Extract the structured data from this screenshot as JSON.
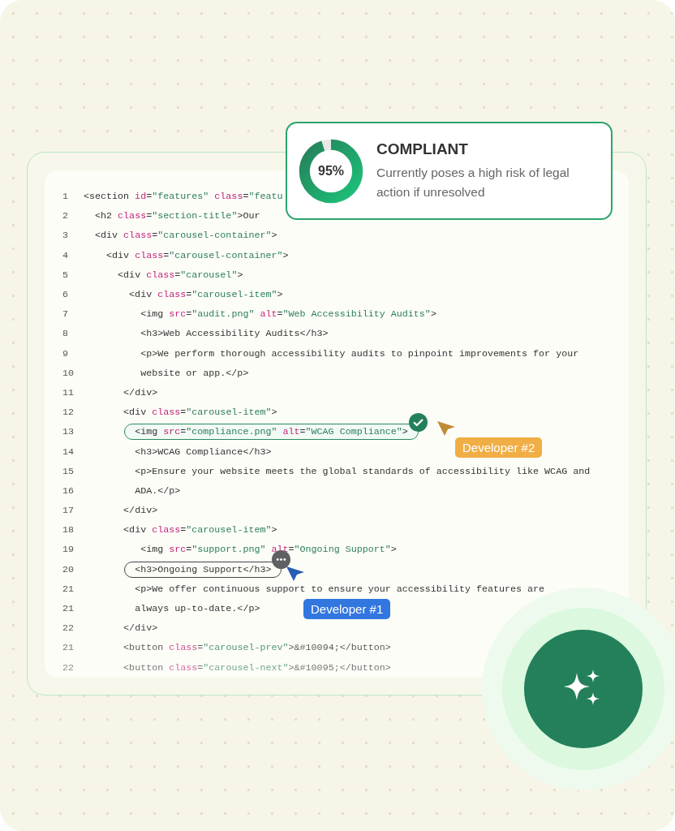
{
  "compliance_card": {
    "score": "95%",
    "level": 0.95,
    "title": "COMPLIANT",
    "description": "Currently poses a high risk of legal action if unresolved"
  },
  "code_lines": [
    {
      "number": "1",
      "tokens": [
        {
          "kind": "tag",
          "text": "<section"
        },
        {
          "kind": "attr",
          "text": " id"
        },
        {
          "kind": "tag",
          "text": "="
        },
        {
          "kind": "str",
          "text": "\"features\""
        },
        {
          "kind": "attr",
          "text": " class"
        },
        {
          "kind": "tag",
          "text": "="
        },
        {
          "kind": "str",
          "text": "\"featu"
        }
      ]
    },
    {
      "number": "2",
      "tokens": [
        {
          "kind": "tag",
          "text": "  <h2"
        },
        {
          "kind": "attr",
          "text": " class"
        },
        {
          "kind": "tag",
          "text": "="
        },
        {
          "kind": "str",
          "text": "\"section-title\""
        },
        {
          "kind": "tag",
          "text": ">Our"
        }
      ]
    },
    {
      "number": "3",
      "tokens": [
        {
          "kind": "tag",
          "text": "  <div"
        },
        {
          "kind": "attr",
          "text": " class"
        },
        {
          "kind": "tag",
          "text": "="
        },
        {
          "kind": "str",
          "text": "\"carousel-container\""
        },
        {
          "kind": "tag",
          "text": ">"
        }
      ]
    },
    {
      "number": "4",
      "tokens": [
        {
          "kind": "tag",
          "text": "    <div"
        },
        {
          "kind": "attr",
          "text": " class"
        },
        {
          "kind": "tag",
          "text": "="
        },
        {
          "kind": "str",
          "text": "\"carousel-container\""
        },
        {
          "kind": "tag",
          "text": ">"
        }
      ]
    },
    {
      "number": "5",
      "tokens": [
        {
          "kind": "tag",
          "text": "      <div"
        },
        {
          "kind": "attr",
          "text": " class"
        },
        {
          "kind": "tag",
          "text": "="
        },
        {
          "kind": "str",
          "text": "\"carousel\""
        },
        {
          "kind": "tag",
          "text": ">"
        }
      ]
    },
    {
      "number": "6",
      "tokens": [
        {
          "kind": "tag",
          "text": "        <div"
        },
        {
          "kind": "attr",
          "text": " class"
        },
        {
          "kind": "tag",
          "text": "="
        },
        {
          "kind": "str",
          "text": "\"carousel-item\""
        },
        {
          "kind": "tag",
          "text": ">"
        }
      ]
    },
    {
      "number": "7",
      "tokens": [
        {
          "kind": "tag",
          "text": "          <img"
        },
        {
          "kind": "attr",
          "text": " src"
        },
        {
          "kind": "tag",
          "text": "="
        },
        {
          "kind": "str",
          "text": "\"audit.png\""
        },
        {
          "kind": "attr",
          "text": " alt"
        },
        {
          "kind": "tag",
          "text": "="
        },
        {
          "kind": "str",
          "text": "\"Web Accessibility Audits\""
        },
        {
          "kind": "tag",
          "text": ">"
        }
      ]
    },
    {
      "number": "8",
      "tokens": [
        {
          "kind": "tag",
          "text": "          <h3>Web Accessibility Audits</h3>"
        }
      ]
    },
    {
      "number": "9",
      "tokens": [
        {
          "kind": "tag",
          "text": "          <p>We perform thorough accessibility audits to pinpoint improvements for your"
        }
      ]
    },
    {
      "number": "10",
      "tokens": [
        {
          "kind": "tag",
          "text": "          website or app.</p>"
        }
      ]
    },
    {
      "number": "11",
      "tokens": [
        {
          "kind": "tag",
          "text": "       </div>"
        }
      ]
    },
    {
      "number": "12",
      "tokens": [
        {
          "kind": "tag",
          "text": "       <div"
        },
        {
          "kind": "attr",
          "text": " class"
        },
        {
          "kind": "tag",
          "text": "="
        },
        {
          "kind": "str",
          "text": "\"carousel-item\""
        },
        {
          "kind": "tag",
          "text": ">"
        }
      ]
    },
    {
      "number": "13",
      "kind": "approved",
      "tokens": [
        {
          "kind": "tag",
          "text": "         <img"
        },
        {
          "kind": "attr",
          "text": " src"
        },
        {
          "kind": "tag",
          "text": "="
        },
        {
          "kind": "str",
          "text": "\"compliance.png\""
        },
        {
          "kind": "attr",
          "text": " alt"
        },
        {
          "kind": "tag",
          "text": "="
        },
        {
          "kind": "str",
          "text": "\"WCAG Compliance\""
        },
        {
          "kind": "tag",
          "text": ">"
        }
      ]
    },
    {
      "number": "14",
      "tokens": [
        {
          "kind": "tag",
          "text": "         <h3>WCAG Compliance</h3>"
        }
      ]
    },
    {
      "number": "15",
      "tokens": [
        {
          "kind": "tag",
          "text": "         <p>Ensure your website meets the global standards of accessibility like WCAG and"
        }
      ]
    },
    {
      "number": "16",
      "tokens": [
        {
          "kind": "tag",
          "text": "         ADA.</p>"
        }
      ]
    },
    {
      "number": "17",
      "tokens": [
        {
          "kind": "tag",
          "text": "       </div>"
        }
      ]
    },
    {
      "number": "18",
      "tokens": [
        {
          "kind": "tag",
          "text": "       <div"
        },
        {
          "kind": "attr",
          "text": " class"
        },
        {
          "kind": "tag",
          "text": "="
        },
        {
          "kind": "str",
          "text": "\"carousel-item\""
        },
        {
          "kind": "tag",
          "text": ">"
        }
      ]
    },
    {
      "number": "19",
      "tokens": [
        {
          "kind": "tag",
          "text": "          <img"
        },
        {
          "kind": "attr",
          "text": " src"
        },
        {
          "kind": "tag",
          "text": "="
        },
        {
          "kind": "str",
          "text": "\"support.png\""
        },
        {
          "kind": "attr",
          "text": " alt"
        },
        {
          "kind": "tag",
          "text": "="
        },
        {
          "kind": "str",
          "text": "\"Ongoing Support\""
        },
        {
          "kind": "tag",
          "text": ">"
        }
      ]
    },
    {
      "number": "20",
      "kind": "comment",
      "tokens": [
        {
          "kind": "tag",
          "text": "         <h3>Ongoing Support</h3>"
        }
      ]
    },
    {
      "number": "21",
      "tokens": [
        {
          "kind": "tag",
          "text": "         <p>We offer continuous support to ensure your accessibility features are"
        }
      ]
    },
    {
      "number": "21",
      "tokens": [
        {
          "kind": "tag",
          "text": "         always up-to-date.</p>"
        }
      ]
    },
    {
      "number": "22",
      "tokens": [
        {
          "kind": "tag",
          "text": "       </div>"
        }
      ]
    },
    {
      "number": "21",
      "tokens": [
        {
          "kind": "tag",
          "text": "       <button"
        },
        {
          "kind": "attr",
          "text": " class"
        },
        {
          "kind": "tag",
          "text": "="
        },
        {
          "kind": "str",
          "text": "\"carousel-prev\""
        },
        {
          "kind": "tag",
          "text": ">&#10094;</button>"
        }
      ]
    },
    {
      "number": "22",
      "tokens": [
        {
          "kind": "tag",
          "text": "       <button"
        },
        {
          "kind": "attr",
          "text": " class"
        },
        {
          "kind": "tag",
          "text": "="
        },
        {
          "kind": "str",
          "text": "\"carousel-next\""
        },
        {
          "kind": "tag",
          "text": ">&#10095;</button>"
        }
      ]
    }
  ],
  "cursors": [
    {
      "label": "Developer #2",
      "color": "#f0ae45"
    },
    {
      "label": "Developer #1",
      "color": "#3276e0"
    }
  ]
}
